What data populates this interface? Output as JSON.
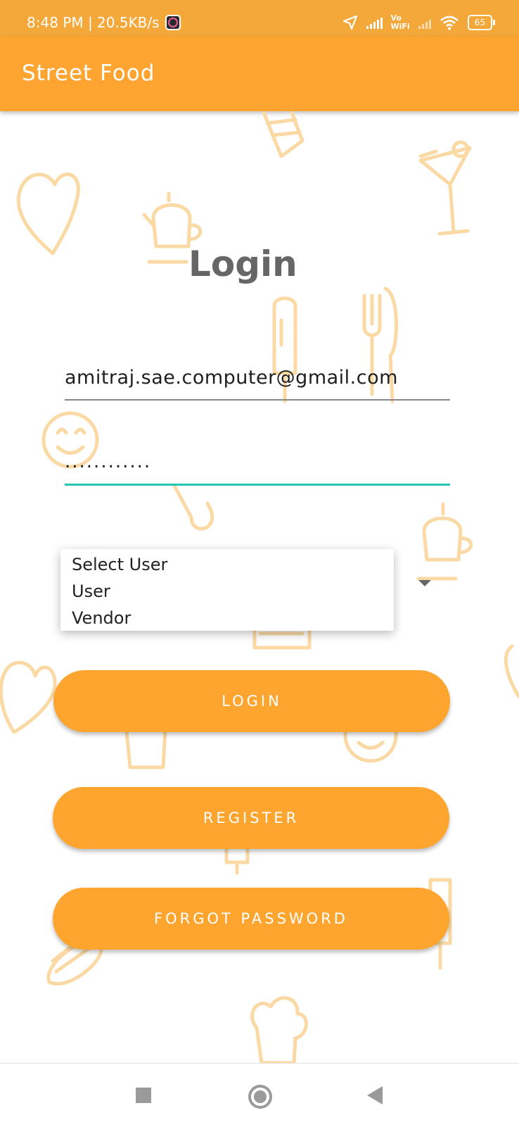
{
  "status_bar": {
    "time_speed": "8:48 PM | 20.5KB/s",
    "vowifi": "Vo\nWiFi",
    "battery": "65"
  },
  "app_bar": {
    "title": "Street Food"
  },
  "login": {
    "title": "Login",
    "email_value": "amitraj.sae.computer@gmail.com",
    "password_value": "............"
  },
  "user_type_dropdown": {
    "options": [
      "Select User",
      "User",
      "Vendor"
    ]
  },
  "buttons": {
    "login": "LOGIN",
    "register": "REGISTER",
    "forgot_password": "FORGOT PASSWORD"
  },
  "colors": {
    "primary": "#fea531",
    "accent": "#26c6b4",
    "doodle": "#fbd9a4"
  }
}
